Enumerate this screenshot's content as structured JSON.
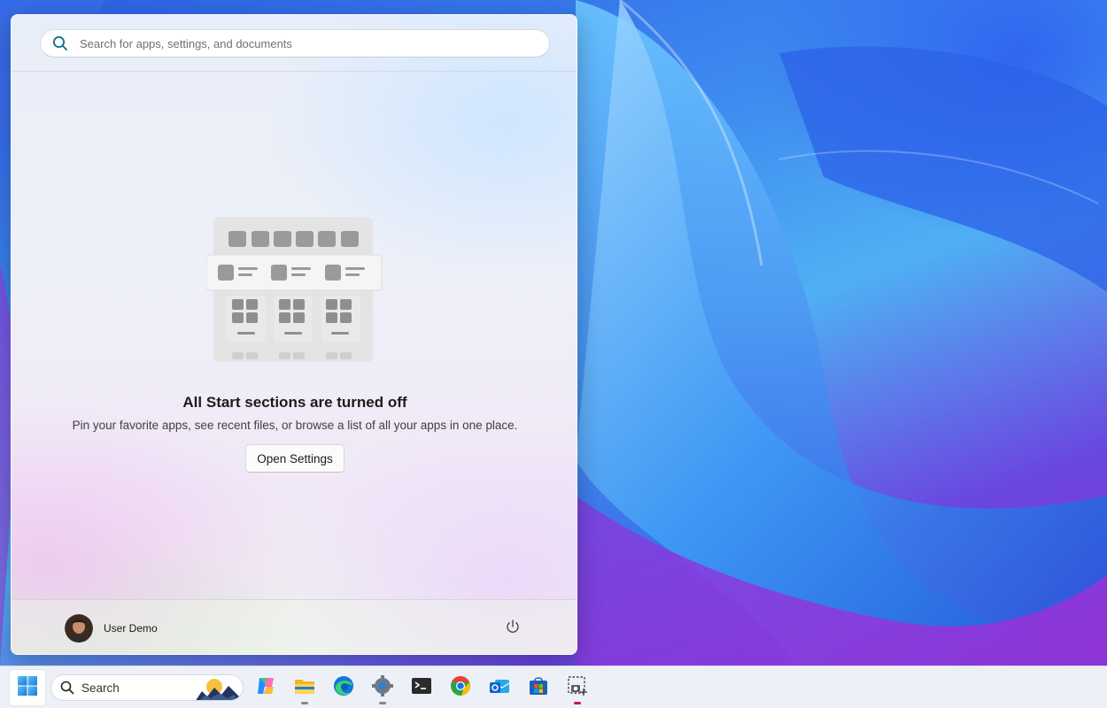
{
  "start_menu": {
    "search": {
      "placeholder": "Search for apps, settings, and documents"
    },
    "empty_state": {
      "title": "All Start sections are turned off",
      "subtitle": "Pin your favorite apps, see recent files, or browse a list of all your apps in one place.",
      "button_label": "Open Settings"
    },
    "footer": {
      "user_name": "User Demo"
    }
  },
  "taskbar": {
    "search_label": "Search",
    "apps": [
      "start-icon",
      "copilot-icon",
      "file-explorer-icon",
      "edge-icon",
      "settings-icon",
      "terminal-icon",
      "chrome-icon",
      "outlook-icon",
      "store-icon",
      "snipping-tool-icon"
    ]
  },
  "colors": {
    "accent": "#0067c0",
    "taskbar_bg": "#eef0f7",
    "wallpaper_primary": "#3f8cf0"
  }
}
